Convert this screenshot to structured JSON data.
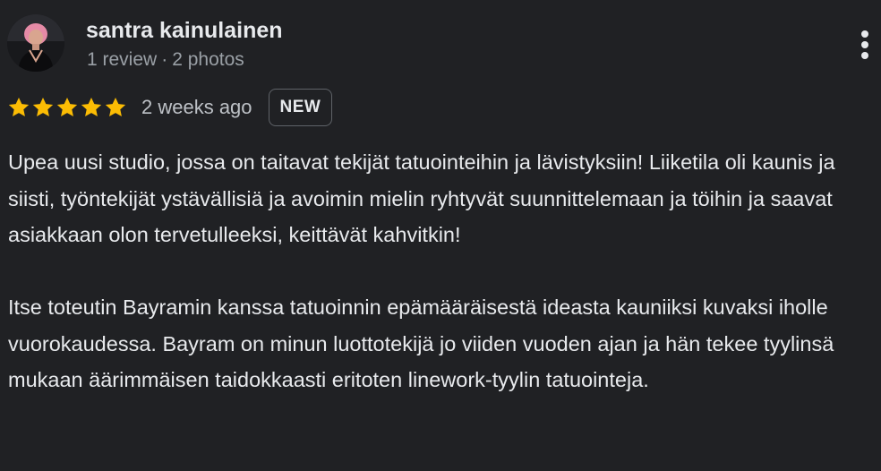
{
  "reviewer": {
    "name": "santra kainulainen",
    "review_count": "1 review",
    "separator": "·",
    "photo_count": "2 photos",
    "avatar_icon": "avatar-photo"
  },
  "menu": {
    "icon": "more-vert-icon"
  },
  "rating": {
    "stars": 5,
    "max_stars": 5,
    "star_color": "#fbbc04",
    "date": "2 weeks ago",
    "badge": "NEW"
  },
  "review": {
    "paragraphs": [
      "Upea uusi studio, jossa on taitavat tekijät tatuointeihin ja lävistyksiin! Liiketila oli kaunis ja siisti, työntekijät ystävällisiä ja avoimin mielin ryhtyvät suunnittelemaan ja töihin ja saavat asiakkaan olon tervetulleeksi, keittävät kahvitkin!",
      "Itse toteutin Bayramin kanssa tatuoinnin epämääräisestä ideasta kauniiksi kuvaksi iholle vuorokaudessa. Bayram on minun luottotekijä jo viiden vuoden ajan ja hän tekee tyylinsä mukaan äärimmäisen taidokkaasti eritoten linework-tyylin tatuointeja."
    ]
  },
  "colors": {
    "background": "#202124",
    "text": "#e8eaed",
    "secondary_text": "#9aa0a6",
    "badge_border": "#5f6368"
  }
}
